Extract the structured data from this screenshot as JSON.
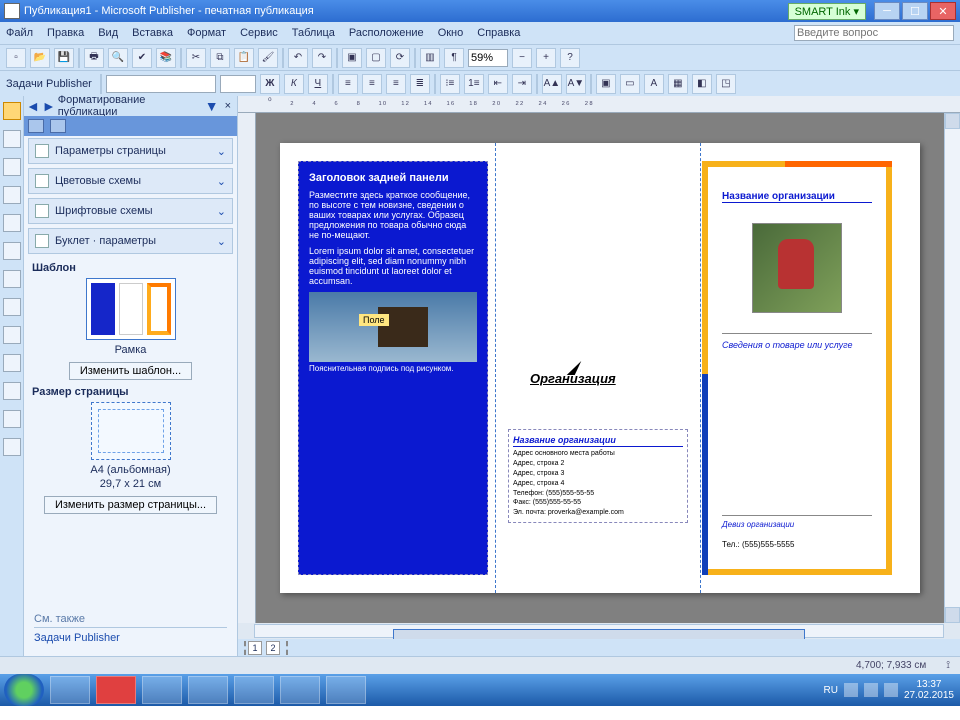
{
  "window": {
    "title": "Публикация1 - Microsoft Publisher - печатная публикация",
    "smart_ink": "SMART Ink ▾"
  },
  "menu": {
    "file": "Файл",
    "edit": "Правка",
    "view": "Вид",
    "insert": "Вставка",
    "format": "Формат",
    "service": "Сервис",
    "table": "Таблица",
    "arrange": "Расположение",
    "window": "Окно",
    "help": "Справка",
    "ask_placeholder": "Введите вопрос"
  },
  "toolbar": {
    "zoom": "59%"
  },
  "toolbar2": {
    "label": "Задачи Publisher"
  },
  "taskpane": {
    "title": "Форматирование публикации",
    "sections": {
      "page_params": "Параметры страницы",
      "color_schemes": "Цветовые схемы",
      "font_schemes": "Шрифтовые схемы",
      "booklet": "Буклет · параметры"
    },
    "template": {
      "heading": "Шаблон",
      "name": "Рамка",
      "change_btn": "Изменить шаблон..."
    },
    "pagesize": {
      "heading": "Размер страницы",
      "name": "A4 (альбомная)",
      "dim": "29,7 x 21 см",
      "change_btn": "Изменить размер страницы..."
    },
    "seealso": {
      "heading": "См. также",
      "link": "Задачи Publisher"
    }
  },
  "brochure": {
    "back": {
      "title": "Заголовок задней панели",
      "para1": "Разместите здесь краткое сообщение, по высоте с тем новизне, сведении о ваших товарах или услугах. Образец предложения по товара обычно сюда не по-мещают.",
      "para2": "Lorem ipsum dolor sit amet, consectetuer adipiscing elit, sed diam nonummy nibh euismod tincidunt ut laoreet dolor et accumsan.",
      "tag": "Поле",
      "caption": "Пояснительная подпись под рисунком."
    },
    "middle": {
      "org_logo": "Организация",
      "info_title": "Название организации",
      "addr1": "Адрес основного места работы",
      "addr2": "Адрес, строка 2",
      "addr3": "Адрес, строка 3",
      "addr4": "Адрес, строка 4",
      "phone": "Телефон: (555)555-55-55",
      "fax": "Факс: (555)555-55-55",
      "email": "Эл. почта: proverka@example.com"
    },
    "front": {
      "org_name": "Название организации",
      "subtitle": "Сведения о товаре или услуге",
      "motto": "Девиз организации",
      "phone": "Тел.: (555)555-5555"
    }
  },
  "pagenav": {
    "p1": "1",
    "p2": "2"
  },
  "status": {
    "coords": "4,700; 7,933 см",
    "lang": "RU"
  },
  "tray": {
    "time": "13:37",
    "date": "27.02.2015"
  }
}
